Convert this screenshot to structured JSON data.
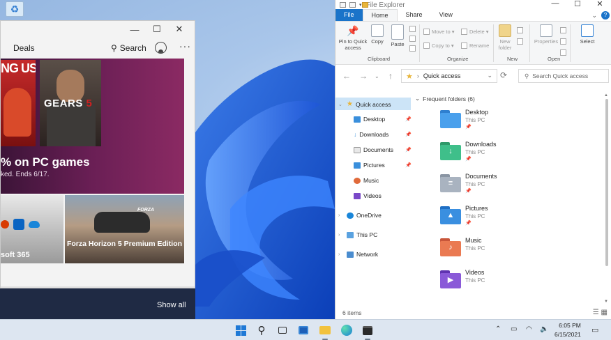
{
  "store": {
    "deals": "Deals",
    "search": "Search",
    "more": "···",
    "hero_tile_1": "NG US",
    "hero_tile_2_a": "GEARS",
    "hero_tile_2_b": "5",
    "hero_title": "% on PC games",
    "hero_sub": "ked. Ends 6/17.",
    "card_1": "soft 365",
    "card_2_logo": "FORZA",
    "card_2": "Forza Horizon 5 Premium Edition",
    "show_all": "Show all",
    "win_min": "—",
    "win_max": "☐",
    "win_close": "✕"
  },
  "explorer": {
    "title": "File Explorer",
    "tabs": [
      "File",
      "Home",
      "Share",
      "View"
    ],
    "help": "?",
    "ribbon": {
      "pin": "Pin to Quick access",
      "copy": "Copy",
      "paste": "Paste",
      "move_to": "Move to ▾",
      "copy_to": "Copy to ▾",
      "delete": "Delete ▾",
      "rename": "Rename",
      "new_folder": "New folder",
      "properties": "Properties",
      "select": "Select",
      "groups": [
        "Clipboard",
        "Organize",
        "New",
        "Open"
      ]
    },
    "address": "Quick access",
    "search_placeholder": "Search Quick access",
    "nav": {
      "quick_access": "Quick access",
      "items": [
        "Desktop",
        "Downloads",
        "Documents",
        "Pictures",
        "Music",
        "Videos"
      ],
      "onedrive": "OneDrive",
      "this_pc": "This PC",
      "network": "Network"
    },
    "frequent_header": "Frequent folders (6)",
    "folders": [
      {
        "name": "Desktop",
        "loc": "This PC"
      },
      {
        "name": "Downloads",
        "loc": "This PC"
      },
      {
        "name": "Documents",
        "loc": "This PC"
      },
      {
        "name": "Pictures",
        "loc": "This PC"
      },
      {
        "name": "Music",
        "loc": "This PC"
      },
      {
        "name": "Videos",
        "loc": "This PC"
      }
    ],
    "status": "6 items"
  },
  "taskbar": {
    "time": "6:05 PM",
    "date": "6/15/2021"
  },
  "colors": {
    "accent": "#1a73c9",
    "folder_yellow": "#e8b53a",
    "store_hero": "#6a1f55",
    "taskbar": "#dde6f1"
  }
}
